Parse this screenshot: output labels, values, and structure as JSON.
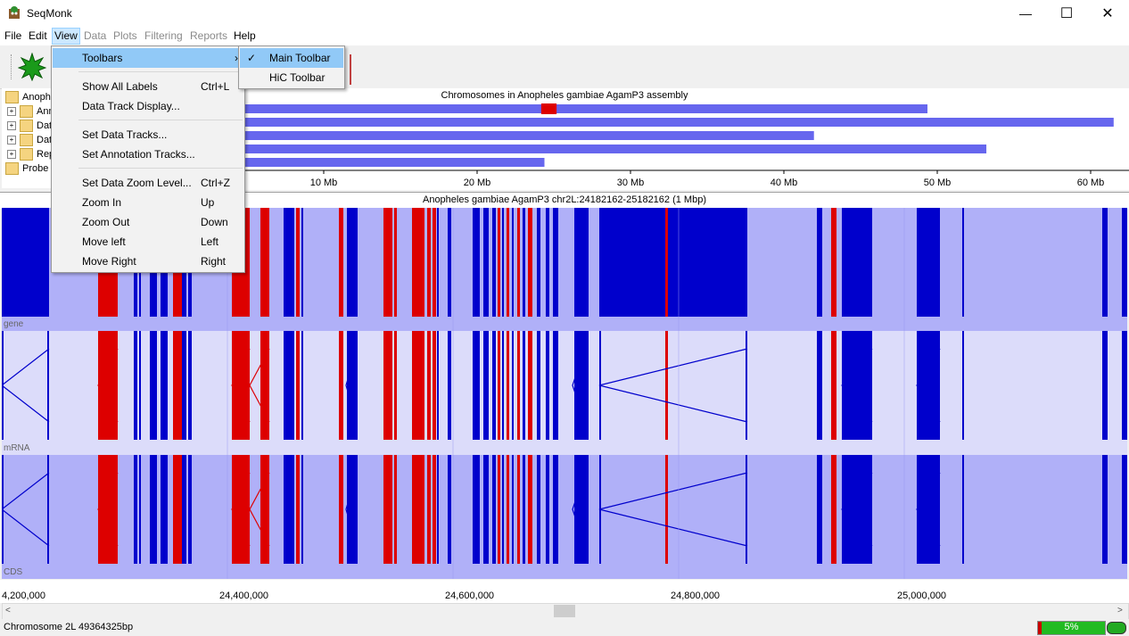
{
  "window": {
    "title": "SeqMonk",
    "minimize": "—",
    "maximize": "☐",
    "close": "✕"
  },
  "menubar": {
    "items": [
      {
        "label": "File",
        "enabled": true
      },
      {
        "label": "Edit",
        "enabled": true
      },
      {
        "label": "View",
        "enabled": true,
        "active": true
      },
      {
        "label": "Data",
        "enabled": false
      },
      {
        "label": "Plots",
        "enabled": false
      },
      {
        "label": "Filtering",
        "enabled": false
      },
      {
        "label": "Reports",
        "enabled": false
      },
      {
        "label": "Help",
        "enabled": true
      }
    ]
  },
  "view_menu": {
    "toolbars": "Toolbars",
    "show_all_labels": "Show All Labels",
    "show_all_labels_sc": "Ctrl+L",
    "data_track_display": "Data Track Display...",
    "set_data_tracks": "Set Data Tracks...",
    "set_annotation_tracks": "Set Annotation Tracks...",
    "set_data_zoom": "Set Data Zoom Level...",
    "set_data_zoom_sc": "Ctrl+Z",
    "zoom_in": "Zoom In",
    "zoom_in_sc": "Up",
    "zoom_out": "Zoom Out",
    "zoom_out_sc": "Down",
    "move_left": "Move left",
    "move_left_sc": "Left",
    "move_right": "Move Right",
    "move_right_sc": "Right"
  },
  "toolbars_submenu": {
    "main_toolbar": "Main Toolbar",
    "main_toolbar_checked": true,
    "hic_toolbar": "HiC Toolbar",
    "hic_toolbar_checked": false
  },
  "tree": {
    "root": "Anophe",
    "items": [
      "Ann",
      "Dat",
      "Dat",
      "Rep"
    ],
    "probe": "Probe L"
  },
  "chromosome_view": {
    "title": "Chromosomes in Anopheles gambiae AgamP3 assembly",
    "unit": "Mb",
    "axis_max_mb": 62,
    "tick_labels": [
      "10 Mb",
      "20 Mb",
      "30 Mb",
      "40 Mb",
      "50 Mb",
      "60 Mb"
    ],
    "tick_values_mb": [
      10,
      20,
      30,
      40,
      50,
      60
    ],
    "chromosome_lengths_mb": [
      49.36,
      61.5,
      41.96,
      53.2,
      24.39
    ],
    "selected_region_mb": [
      24.18,
      25.18
    ],
    "bar_color": "#6666ee",
    "selection_color": "#dd0000"
  },
  "region_view": {
    "title": "Anopheles gambiae AgamP3 chr2L:24182162-25182162 (1 Mbp)",
    "tracks": [
      "gene",
      "mRNA",
      "CDS"
    ],
    "track_colors": {
      "gene_bg": "#b0b0f8",
      "mrna_bg": "#dcdcfa",
      "cds_bg": "#b0b0f8",
      "forward": "#0000cc",
      "reverse": "#dd0000"
    },
    "axis_labels": [
      "4,200,000",
      "24,400,000",
      "24,600,000",
      "24,800,000",
      "25,000,000"
    ]
  },
  "status": {
    "text": "Chromosome 2L 49364325bp",
    "progress": "5%"
  }
}
